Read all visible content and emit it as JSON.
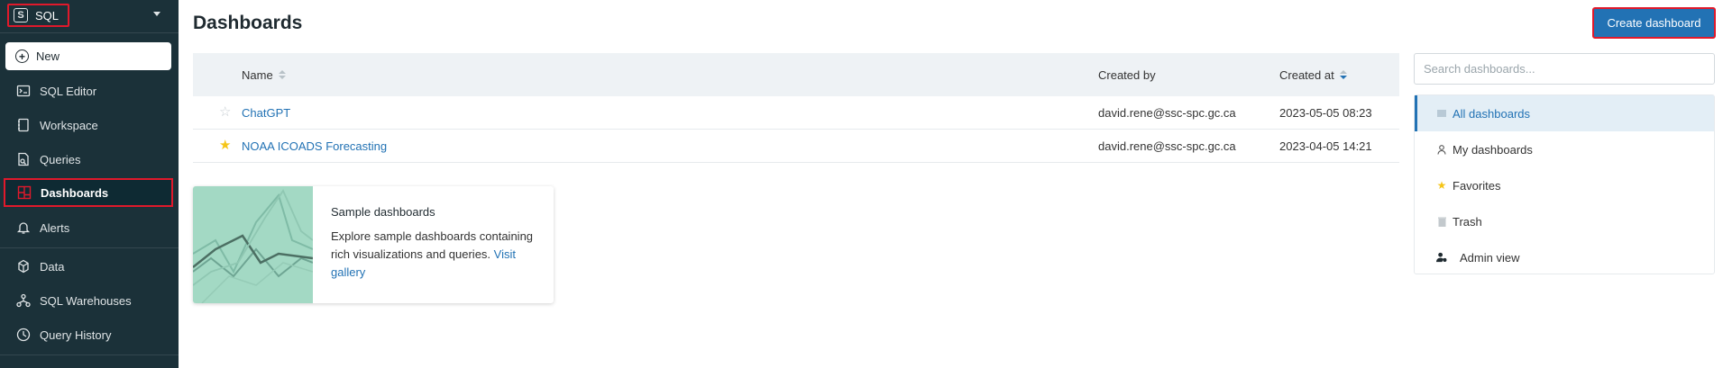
{
  "sidebar": {
    "persona": {
      "letter": "S",
      "label": "SQL"
    },
    "new_label": "New",
    "items": [
      {
        "label": "SQL Editor",
        "icon": "sql-editor-icon"
      },
      {
        "label": "Workspace",
        "icon": "workspace-icon"
      },
      {
        "label": "Queries",
        "icon": "queries-icon"
      },
      {
        "label": "Dashboards",
        "icon": "dashboards-icon"
      },
      {
        "label": "Alerts",
        "icon": "bell-icon"
      },
      {
        "label": "Data",
        "icon": "data-icon"
      },
      {
        "label": "SQL Warehouses",
        "icon": "warehouse-icon"
      },
      {
        "label": "Query History",
        "icon": "clock-icon"
      }
    ]
  },
  "header": {
    "title": "Dashboards",
    "create_label": "Create dashboard"
  },
  "table": {
    "columns": {
      "name": "Name",
      "created_by": "Created by",
      "created_at": "Created at"
    },
    "rows": [
      {
        "name": "ChatGPT",
        "created_by": "david.rene@ssc-spc.gc.ca",
        "created_at": "2023-05-05 08:23",
        "favorite": false
      },
      {
        "name": "NOAA ICOADS Forecasting",
        "created_by": "david.rene@ssc-spc.gc.ca",
        "created_at": "2023-04-05 14:21",
        "favorite": true
      }
    ]
  },
  "sample": {
    "title": "Sample dashboards",
    "description": "Explore sample dashboards containing rich visualizations and queries.",
    "link": "Visit gallery"
  },
  "search": {
    "placeholder": "Search dashboards..."
  },
  "filters": {
    "all": "All dashboards",
    "mine": "My dashboards",
    "favorites": "Favorites",
    "trash": "Trash",
    "admin": "Admin view"
  },
  "colors": {
    "sidebar_bg": "#1b3139",
    "accent": "#2272b4",
    "highlight": "#e0192b"
  }
}
